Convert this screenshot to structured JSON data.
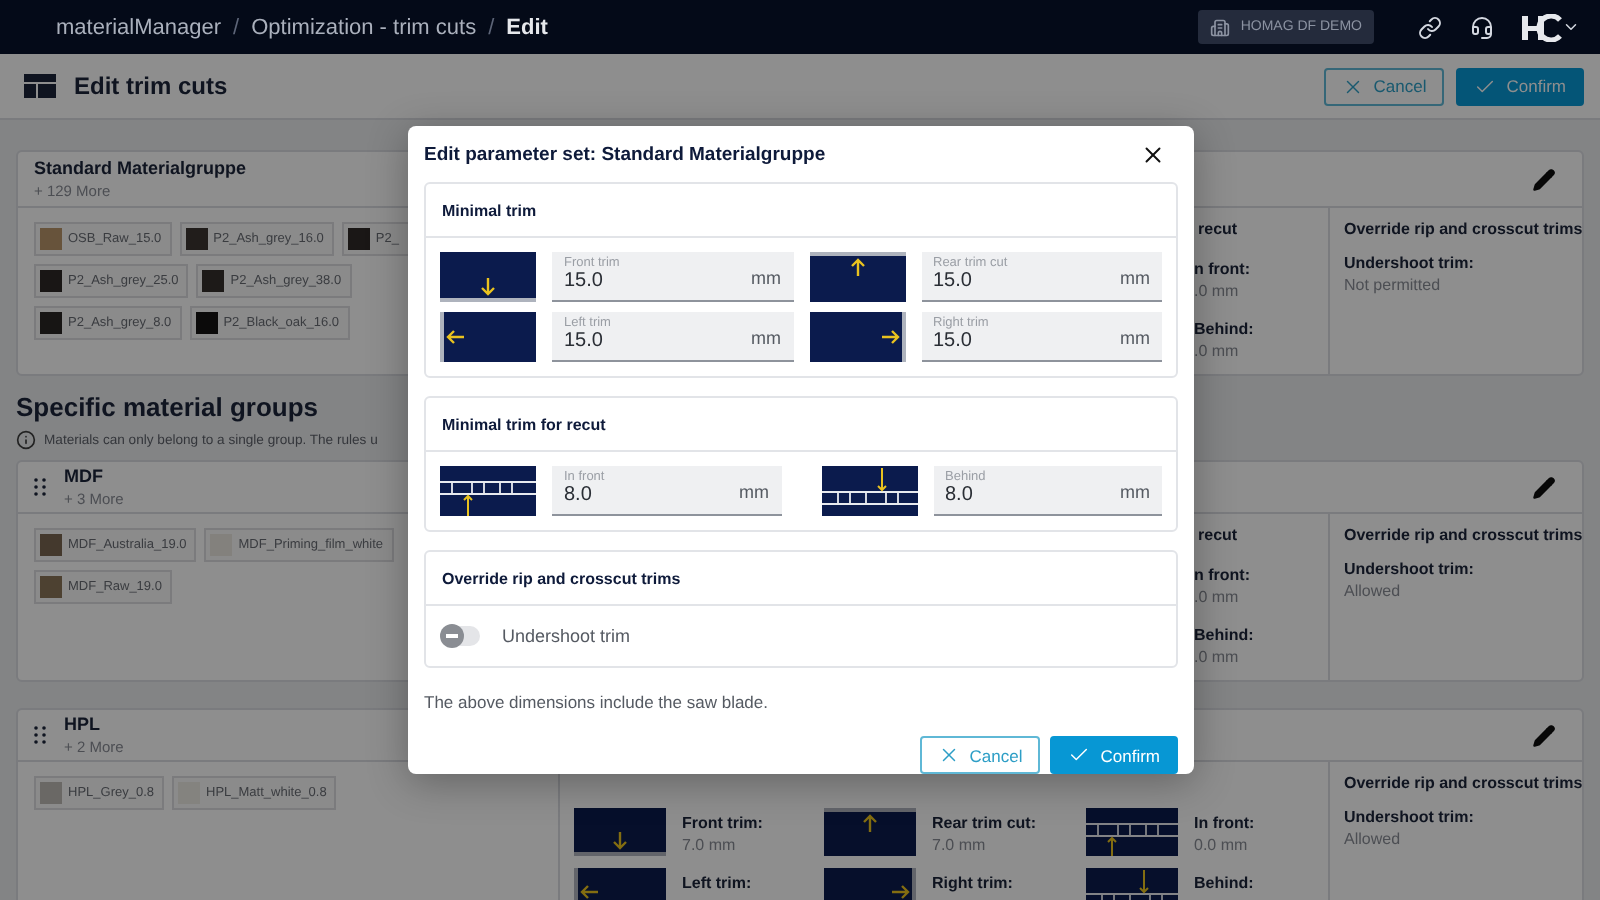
{
  "top_bar": {
    "breadcrumbs": [
      {
        "label": "materialManager",
        "current": false
      },
      {
        "label": "Optimization - trim cuts",
        "current": false
      },
      {
        "label": "Edit",
        "current": true
      }
    ],
    "separator": "/",
    "tenant": "HOMAG DF DEMO"
  },
  "header": {
    "title": "Edit trim cuts",
    "buttons": [
      {
        "label": "Cancel",
        "kind": "secondary"
      },
      {
        "label": "Confirm",
        "kind": "primary"
      }
    ]
  },
  "standard_group": {
    "name": "Standard Materialgruppe",
    "more": "+ 129 More",
    "draggable": false,
    "materials": [
      {
        "label": "OSB_Raw_15.0",
        "color": "#67533b"
      },
      {
        "label": "P2_Ash_grey_16.0",
        "color": "#211d1b"
      },
      {
        "label": "P2_",
        "color": "#1a1716"
      },
      {
        "label": "P2_Ash_grey_25.0",
        "color": "#191615"
      },
      {
        "label": "P2_Ash_grey_38.0",
        "color": "#1d1a18"
      },
      {
        "label": "P2_Ash_grey_8.0",
        "color": "#171514"
      },
      {
        "label": "P2_Black_oak_16.0",
        "color": "#0b0a0a"
      }
    ],
    "recut": {
      "title": "recut",
      "items": [
        {
          "label": "n front:",
          "value": ".0 mm"
        },
        {
          "label": "Behind:",
          "value": ".0 mm"
        }
      ]
    },
    "override": {
      "title": "Override rip and crosscut trims",
      "label": "Undershoot trim:",
      "value": "Not permitted"
    }
  },
  "specific": {
    "title": "Specific material groups",
    "info": "Materials can only belong to a single group. The rules u"
  },
  "groups": [
    {
      "name": "MDF",
      "more": "+ 3 More",
      "draggable": true,
      "materials": [
        {
          "label": "MDF_Australia_19.0",
          "color": "#44392d"
        },
        {
          "label": "MDF_Priming_film_white",
          "color": "#83817d"
        },
        {
          "label": "MDF_Raw_19.0",
          "color": "#4d4131"
        }
      ],
      "recut": {
        "title": "recut",
        "items": [
          {
            "label": "n front:",
            "value": ".0 mm"
          },
          {
            "label": "Behind:",
            "value": ".0 mm"
          }
        ]
      },
      "override": {
        "title": "Override rip and crosscut trims",
        "label": "Undershoot trim:",
        "value": "Allowed"
      }
    },
    {
      "name": "HPL",
      "more": "+ 2 More",
      "draggable": true,
      "materials": [
        {
          "label": "HPL_Grey_0.8",
          "color": "#6a6865"
        },
        {
          "label": "HPL_Matt_white_0.8",
          "color": "#84837f"
        }
      ],
      "trims": [
        {
          "kind": "front",
          "label": "Front trim:",
          "value": "7.0 mm"
        },
        {
          "kind": "rear",
          "label": "Rear trim cut:",
          "value": "7.0 mm"
        },
        {
          "kind": "left",
          "label": "Left trim:"
        },
        {
          "kind": "right",
          "label": "Right trim:"
        }
      ],
      "recut": {
        "items": [
          {
            "kind": "front",
            "label": "In front:",
            "value": "0.0 mm"
          },
          {
            "kind": "rear",
            "label": "Behind:"
          }
        ]
      },
      "override": {
        "title": "Override rip and crosscut trims",
        "label": "Undershoot trim:",
        "value": "Allowed"
      }
    }
  ],
  "modal": {
    "title": "Edit parameter set: Standard Materialgruppe",
    "sections": [
      {
        "kind": "trims",
        "title": "Minimal trim",
        "fields": [
          {
            "kind": "front",
            "label": "Front trim",
            "value": "15.0",
            "unit": "mm"
          },
          {
            "kind": "rear",
            "label": "Rear trim cut",
            "value": "15.0",
            "unit": "mm"
          },
          {
            "kind": "left",
            "label": "Left trim",
            "value": "15.0",
            "unit": "mm"
          },
          {
            "kind": "right",
            "label": "Right trim",
            "value": "15.0",
            "unit": "mm"
          }
        ]
      },
      {
        "kind": "recut",
        "title": "Minimal trim for recut",
        "fields": [
          {
            "kind": "front",
            "label": "In front",
            "value": "8.0",
            "unit": "mm"
          },
          {
            "kind": "rear",
            "label": "Behind",
            "value": "8.0",
            "unit": "mm"
          }
        ]
      },
      {
        "kind": "toggles",
        "title": "Override rip and crosscut trims",
        "options": [
          {
            "label": "Undershoot trim",
            "on": false
          }
        ]
      }
    ],
    "note": "The above dimensions include the saw blade.",
    "buttons": [
      {
        "label": "Cancel",
        "kind": "secondary"
      },
      {
        "label": "Confirm",
        "kind": "primary"
      }
    ]
  }
}
